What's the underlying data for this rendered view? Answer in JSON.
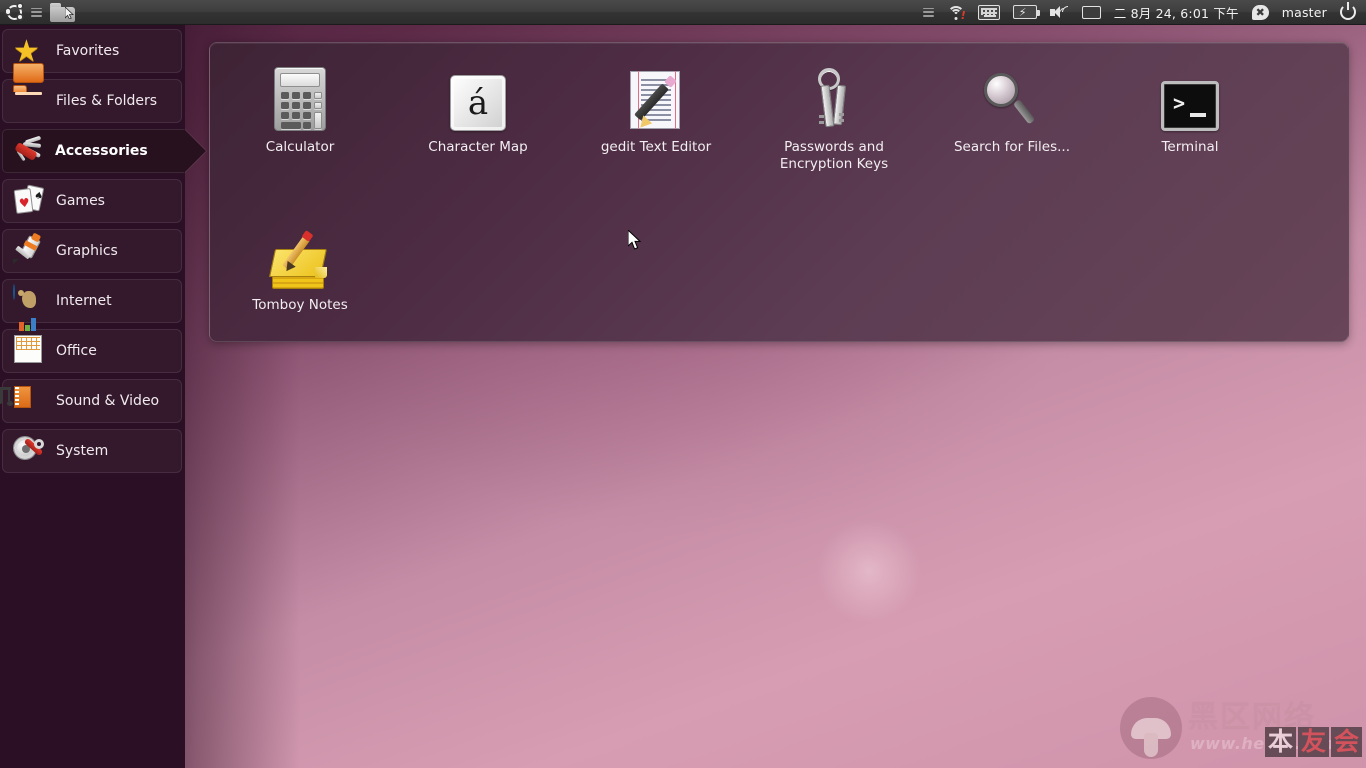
{
  "top_panel": {
    "left_icons": [
      {
        "name": "ubuntu-logo-icon",
        "label": "Ubuntu"
      },
      {
        "name": "menu-icon",
        "label": "Menu"
      },
      {
        "name": "file-manager-icon",
        "label": "Files"
      }
    ],
    "tray": {
      "indicator_lines": "menu-indicator-icon",
      "wifi": "wifi-alert-icon",
      "keyboard": "keyboard-indicator-icon",
      "battery": "battery-charging-icon",
      "volume": "volume-icon",
      "messages": "messaging-envelope-icon",
      "datetime": "二 8月 24,  6:01 下午",
      "user_name": "master",
      "user_status_icon": "user-offline-icon",
      "power": "power-icon"
    }
  },
  "sidebar": {
    "items": [
      {
        "label": "Favorites",
        "icon": "star-icon",
        "selected": false
      },
      {
        "label": "Files & Folders",
        "icon": "folder-icon",
        "selected": false
      },
      {
        "label": "Accessories",
        "icon": "swiss-knife-icon",
        "selected": true
      },
      {
        "label": "Games",
        "icon": "playing-cards-icon",
        "selected": false
      },
      {
        "label": "Graphics",
        "icon": "paint-tube-icon",
        "selected": false
      },
      {
        "label": "Internet",
        "icon": "globe-icon",
        "selected": false
      },
      {
        "label": "Office",
        "icon": "spreadsheet-icon",
        "selected": false
      },
      {
        "label": "Sound & Video",
        "icon": "film-music-icon",
        "selected": false
      },
      {
        "label": "System",
        "icon": "gear-wrench-icon",
        "selected": false
      }
    ]
  },
  "apps": [
    {
      "label": "Calculator",
      "icon": "calculator-icon"
    },
    {
      "label": "Character Map",
      "icon": "character-map-icon",
      "glyph": "á"
    },
    {
      "label": "gedit Text Editor",
      "icon": "gedit-icon"
    },
    {
      "label": "Passwords and\nEncryption Keys",
      "label_line1": "Passwords and",
      "label_line2": "Encryption Keys",
      "icon": "keys-icon"
    },
    {
      "label": "Search for Files...",
      "icon": "magnifier-icon"
    },
    {
      "label": "Terminal",
      "icon": "terminal-icon",
      "prompt": ">"
    },
    {
      "label": "Tomboy Notes",
      "icon": "tomboy-notes-icon"
    }
  ],
  "watermark": {
    "chinese": "黑区网络",
    "url": "www.heiqu.com",
    "overlay": [
      "本",
      "友",
      "会"
    ]
  },
  "colors": {
    "panel_bg": "#5d3d53",
    "sidebar_bg": "#2b0f24",
    "selected_bg": "#27111f",
    "desktop_pink": "#cf93aa",
    "top_panel": "#3a3a3a",
    "accent_orange": "#e06a17"
  }
}
